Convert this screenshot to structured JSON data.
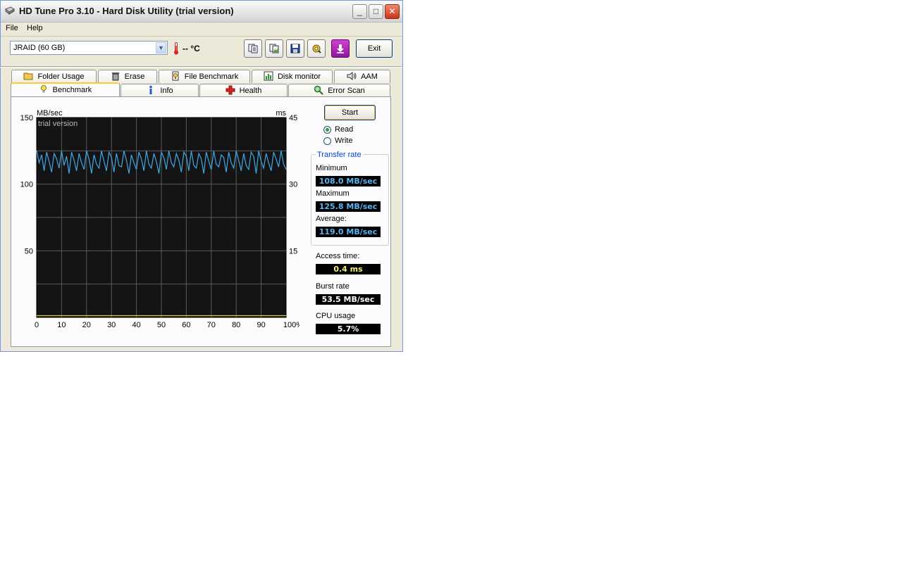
{
  "window": {
    "title": "HD Tune Pro 3.10 - Hard Disk Utility (trial version)",
    "controls": {
      "minimize": "_",
      "maximize": "□",
      "close": "✕"
    }
  },
  "menu": [
    "File",
    "Help"
  ],
  "toolbar": {
    "drive": "JRAID (60 GB)",
    "temperature": "-- °C",
    "icons": [
      "copy-text-icon",
      "copy-image-icon",
      "save-icon",
      "options-icon",
      "download-icon"
    ],
    "exit_label": "Exit"
  },
  "tabs_top": [
    {
      "label": "Folder Usage",
      "icon": "folder-icon"
    },
    {
      "label": "Erase",
      "icon": "trash-icon"
    },
    {
      "label": "File Benchmark",
      "icon": "file-benchmark-icon"
    },
    {
      "label": "Disk monitor",
      "icon": "chart-bars-icon"
    },
    {
      "label": "AAM",
      "icon": "speaker-icon"
    }
  ],
  "tabs_bottom": [
    {
      "label": "Benchmark",
      "icon": "lightbulb-icon",
      "active": true
    },
    {
      "label": "Info",
      "icon": "info-icon"
    },
    {
      "label": "Health",
      "icon": "health-cross-icon"
    },
    {
      "label": "Error Scan",
      "icon": "magnifier-icon"
    }
  ],
  "benchmark": {
    "start_label": "Start",
    "mode_read": "Read",
    "mode_write": "Write",
    "selected_mode": "Read",
    "transfer_rate_title": "Transfer rate",
    "minimum_label": "Minimum",
    "minimum_value": "108.0 MB/sec",
    "maximum_label": "Maximum",
    "maximum_value": "125.8 MB/sec",
    "average_label": "Average:",
    "average_value": "119.0 MB/sec",
    "access_label": "Access time:",
    "access_value": "0.4 ms",
    "burst_label": "Burst rate",
    "burst_value": "53.5 MB/sec",
    "cpu_label": "CPU usage",
    "cpu_value": "5.7%"
  },
  "chart_data": {
    "type": "line",
    "watermark": "trial version",
    "left_unit": "MB/sec",
    "right_unit": "ms",
    "left_ticks": [
      "150",
      "100",
      "50"
    ],
    "right_ticks": [
      "45",
      "30",
      "15"
    ],
    "x_ticks": [
      "0",
      "10",
      "20",
      "30",
      "40",
      "50",
      "60",
      "70",
      "80",
      "90",
      "100%"
    ],
    "xlim": [
      0,
      100
    ],
    "ylim": [
      0,
      150
    ],
    "y2lim": [
      0,
      45
    ],
    "grid": true,
    "colors": {
      "background": "#141414",
      "transfer": "#3fa8e6",
      "access": "#d8d020",
      "grid": "#5a5a5a"
    },
    "series": [
      {
        "id": "transfer",
        "x": [
          0,
          1,
          2,
          3,
          4,
          5,
          6,
          7,
          8,
          9,
          10,
          11,
          12,
          13,
          14,
          15,
          16,
          17,
          18,
          19,
          20,
          21,
          22,
          23,
          24,
          25,
          26,
          27,
          28,
          29,
          30,
          31,
          32,
          33,
          34,
          35,
          36,
          37,
          38,
          39,
          40,
          41,
          42,
          43,
          44,
          45,
          46,
          47,
          48,
          49,
          50,
          51,
          52,
          53,
          54,
          55,
          56,
          57,
          58,
          59,
          60,
          61,
          62,
          63,
          64,
          65,
          66,
          67,
          68,
          69,
          70,
          71,
          72,
          73,
          74,
          75,
          76,
          77,
          78,
          79,
          80,
          81,
          82,
          83,
          84,
          85,
          86,
          87,
          88,
          89,
          90,
          91,
          92,
          93,
          94,
          95,
          96,
          97,
          98,
          99,
          100
        ],
        "values": [
          125,
          116,
          122,
          110,
          124,
          117,
          109,
          123,
          119,
          112,
          125,
          114,
          121,
          108,
          124,
          118,
          110,
          123,
          116,
          111,
          125,
          119,
          108,
          122,
          115,
          112,
          125,
          117,
          110,
          124,
          120,
          109,
          123,
          114,
          113,
          125,
          118,
          108,
          122,
          116,
          111,
          124,
          119,
          110,
          125,
          115,
          112,
          123,
          117,
          108,
          124,
          120,
          111,
          125,
          116,
          113,
          123,
          118,
          109,
          124,
          121,
          110,
          125,
          114,
          112,
          123,
          119,
          108,
          124,
          117,
          111,
          125,
          115,
          113,
          122,
          120,
          109,
          124,
          116,
          112,
          125,
          118,
          110,
          123,
          114,
          111,
          124,
          121,
          108,
          125,
          117,
          112,
          123,
          116,
          110,
          124,
          119,
          113,
          125,
          115,
          111
        ]
      },
      {
        "id": "access",
        "x": [
          0,
          100
        ],
        "values": [
          0.4,
          0.4
        ]
      }
    ]
  }
}
